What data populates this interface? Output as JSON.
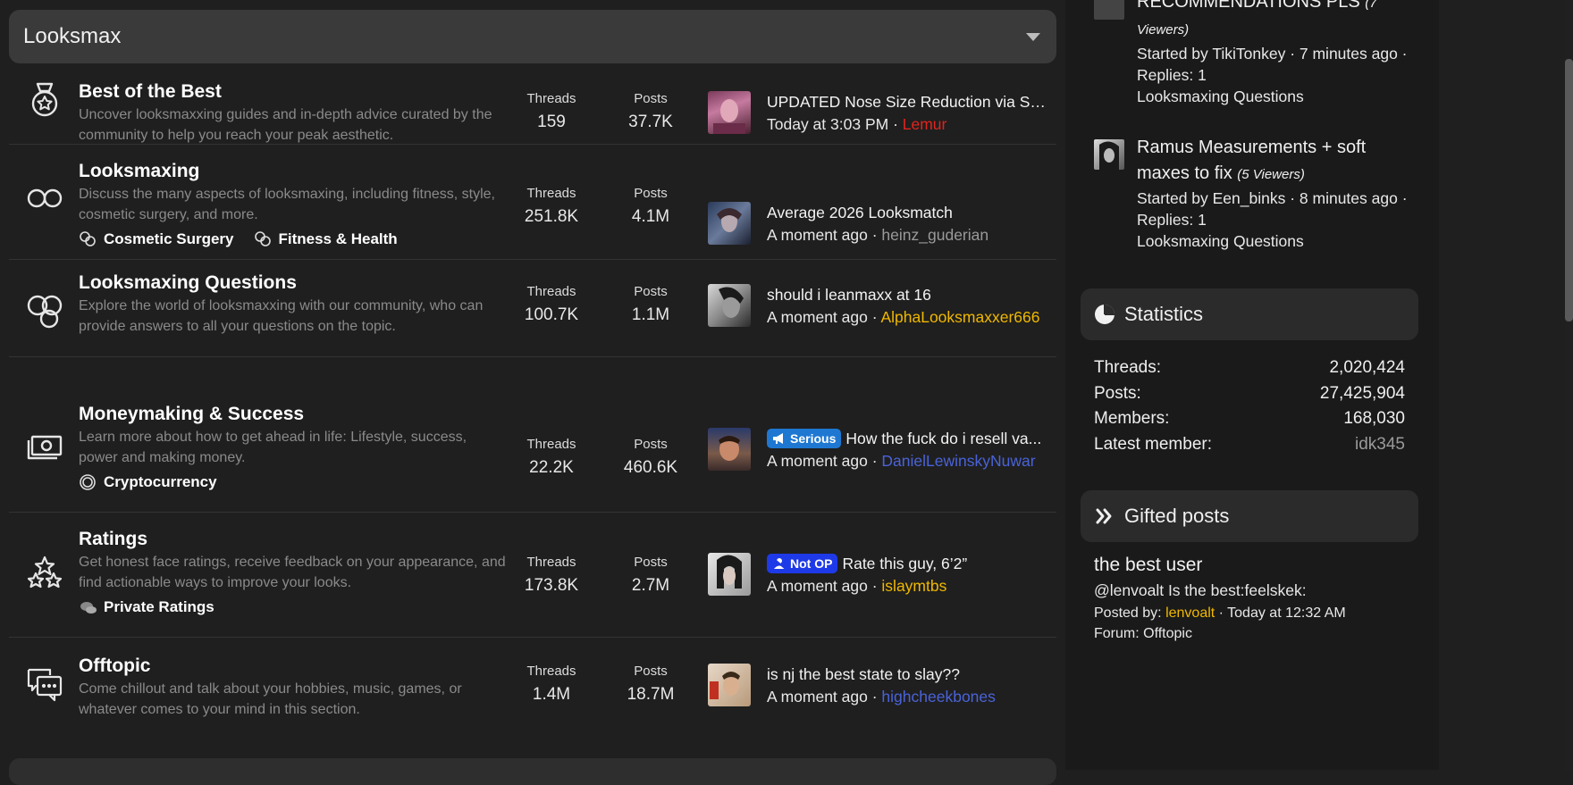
{
  "category": {
    "title": "Looksmax"
  },
  "forums": [
    {
      "title": "Best of the Best",
      "description": "Uncover looksmaxxing guides and in-depth advice curated by the community to help you reach your peak aesthetic.",
      "threads_label": "Threads",
      "threads": "159",
      "posts_label": "Posts",
      "posts": "37.7K",
      "latest_title": "UPDATED Nose Size Reduction via Sof...",
      "latest_time": "Today at 3:03 PM",
      "latest_user": "Lemur",
      "latest_user_color": "#e0241c"
    },
    {
      "title": "Looksmaxing",
      "description": "Discuss the many aspects of looksmaxing, including fitness, style, cosmetic surgery, and more.",
      "subforums": [
        "Cosmetic Surgery",
        "Fitness & Health"
      ],
      "threads_label": "Threads",
      "threads": "251.8K",
      "posts_label": "Posts",
      "posts": "4.1M",
      "latest_title": "Average 2026 Looksmatch",
      "latest_time": "A moment ago",
      "latest_user": "heinz_guderian",
      "latest_user_color": "#9a9a9a"
    },
    {
      "title": "Looksmaxing Questions",
      "description": "Explore the world of looksmaxxing with our community, who can provide answers to all your questions on the topic.",
      "threads_label": "Threads",
      "threads": "100.7K",
      "posts_label": "Posts",
      "posts": "1.1M",
      "latest_title": "should i leanmaxx at 16",
      "latest_time": "A moment ago",
      "latest_user": "AlphaLooksmaxxer666",
      "latest_user_color": "#f0b800"
    },
    {
      "title": "Moneymaking & Success",
      "description": "Learn more about how to get ahead in life: Lifestyle, success, power and making money.",
      "subforums": [
        "Cryptocurrency"
      ],
      "threads_label": "Threads",
      "threads": "22.2K",
      "posts_label": "Posts",
      "posts": "460.6K",
      "latest_badge": "Serious",
      "latest_badge_color": "#1e78d2",
      "latest_title": "How the fuck do i resell va...",
      "latest_time": "A moment ago",
      "latest_user": "DanielLewinskyNuwar",
      "latest_user_color": "#4a63d8"
    },
    {
      "title": "Ratings",
      "description": "Get honest face ratings, receive feedback on your appearance, and find actionable ways to improve your looks.",
      "subforums": [
        "Private Ratings"
      ],
      "threads_label": "Threads",
      "threads": "173.8K",
      "posts_label": "Posts",
      "posts": "2.7M",
      "latest_badge": "Not OP",
      "latest_badge_color": "#1e3ae8",
      "latest_title": "Rate this guy, 6’2”",
      "latest_time": "A moment ago",
      "latest_user": "islaymtbs",
      "latest_user_color": "#f0b800"
    },
    {
      "title": "Offtopic",
      "description": "Come chillout and talk about your hobbies, music, games, or whatever comes to your mind in this section.",
      "threads_label": "Threads",
      "threads": "1.4M",
      "posts_label": "Posts",
      "posts": "18.7M",
      "latest_title": "is nj the best state to slay??",
      "latest_time": "A moment ago",
      "latest_user": "highcheekbones",
      "latest_user_color": "#4a63d8"
    }
  ],
  "sidebar": {
    "trending": [
      {
        "title": "RECOMMENDATIONS PLS",
        "viewers": "(7 Viewers)",
        "started": "Started by TikiTonkey · 7 minutes ago ·",
        "replies": "Replies: 1",
        "forum": "Looksmaxing Questions"
      },
      {
        "title": "Ramus Measurements + soft maxes to fix",
        "viewers": "(5 Viewers)",
        "started": "Started by Een_binks · 8 minutes ago ·",
        "replies": "Replies: 1",
        "forum": "Looksmaxing Questions"
      }
    ],
    "statistics": {
      "heading": "Statistics",
      "rows": [
        {
          "label": "Threads:",
          "value": "2,020,424"
        },
        {
          "label": "Posts:",
          "value": "27,425,904"
        },
        {
          "label": "Members:",
          "value": "168,030"
        },
        {
          "label": "Latest member:",
          "value": "idk345"
        }
      ]
    },
    "gifted": {
      "heading": "Gifted posts",
      "title": "the best user",
      "body": "@lenvoalt Is the best:feelskek:",
      "posted_by_label": "Posted by:",
      "posted_by_user": "lenvoalt",
      "posted_by_color": "#f0b800",
      "posted_time": "· Today at 12:32 AM",
      "forum": "Forum: Offtopic"
    }
  },
  "colors": {
    "background": "#1f1f1f",
    "header": "#3a3a3a",
    "sidebar_block": "#2b2b2b"
  },
  "icons": [
    "medal-icon",
    "infinity-icon",
    "bubbles-icon",
    "money-icon",
    "stars-icon",
    "chat-icon",
    "chart-pie-icon",
    "double-chevron-icon"
  ]
}
